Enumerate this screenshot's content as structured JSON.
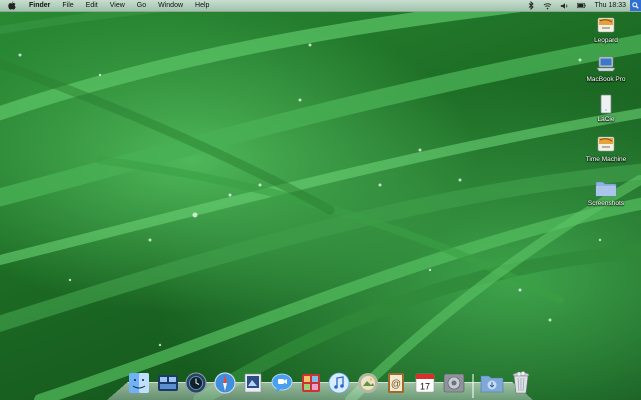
{
  "menubar": {
    "items": [
      "Finder",
      "File",
      "Edit",
      "View",
      "Go",
      "Window",
      "Help"
    ],
    "clock": "Thu 18:33"
  },
  "desktop_icons": [
    {
      "label": "Leopard",
      "icon": "leopard-install-disc-icon"
    },
    {
      "label": "MacBook Pro",
      "icon": "macbook-pro-drive-icon"
    },
    {
      "label": "LaCie",
      "icon": "external-drive-icon"
    },
    {
      "label": "Time Machine",
      "icon": "time-machine-drive-icon"
    },
    {
      "label": "Screenshots",
      "icon": "folder-icon"
    }
  ],
  "dock": {
    "apps": [
      "finder",
      "dashboard",
      "time-machine",
      "safari",
      "preview",
      "ichat",
      "photo-booth",
      "itunes",
      "iphoto",
      "address-book",
      "ical",
      "system-preferences"
    ],
    "others": [
      "downloads-stack",
      "trash"
    ],
    "ical_date": "17"
  },
  "colors": {
    "menubar": "#b3d1bd",
    "grass_dark": "#0f4a18",
    "grass_light": "#4fb85a"
  }
}
